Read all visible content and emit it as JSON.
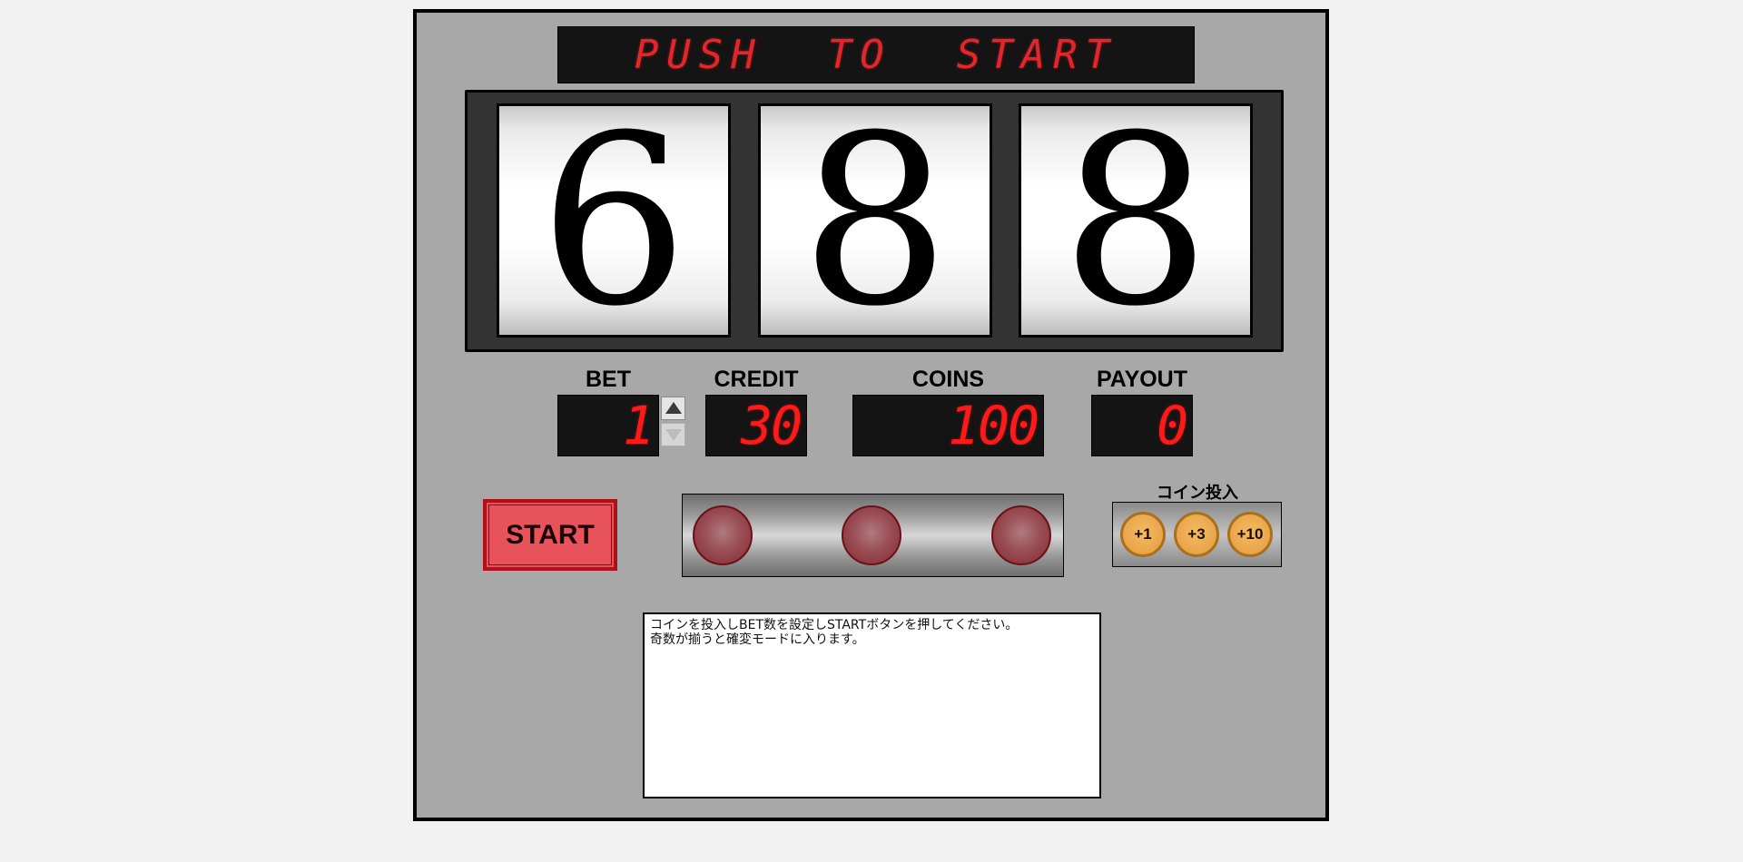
{
  "marquee": {
    "text": "PUSH TO START"
  },
  "reels": [
    "6",
    "8",
    "8"
  ],
  "meters": {
    "bet": {
      "label": "BET",
      "value": "1"
    },
    "credit": {
      "label": "CREDIT",
      "value": "30"
    },
    "coins": {
      "label": "COINS",
      "value": "100"
    },
    "payout": {
      "label": "PAYOUT",
      "value": "0"
    }
  },
  "controls": {
    "start_label": "START",
    "bet_up_icon": "triangle-up-icon",
    "bet_down_icon": "triangle-down-icon"
  },
  "coin_insert": {
    "title": "コイン投入",
    "buttons": [
      "+1",
      "+3",
      "+10"
    ]
  },
  "message": {
    "text": "コインを投入しBET数を設定しSTARTボタンを押してください。\n奇数が揃うと確変モードに入ります。"
  },
  "colors": {
    "segment_red": "#ff1a1a",
    "start_button": "#e8525a",
    "cabinet": "#a8a8a8",
    "coin": "#eaa44a"
  }
}
